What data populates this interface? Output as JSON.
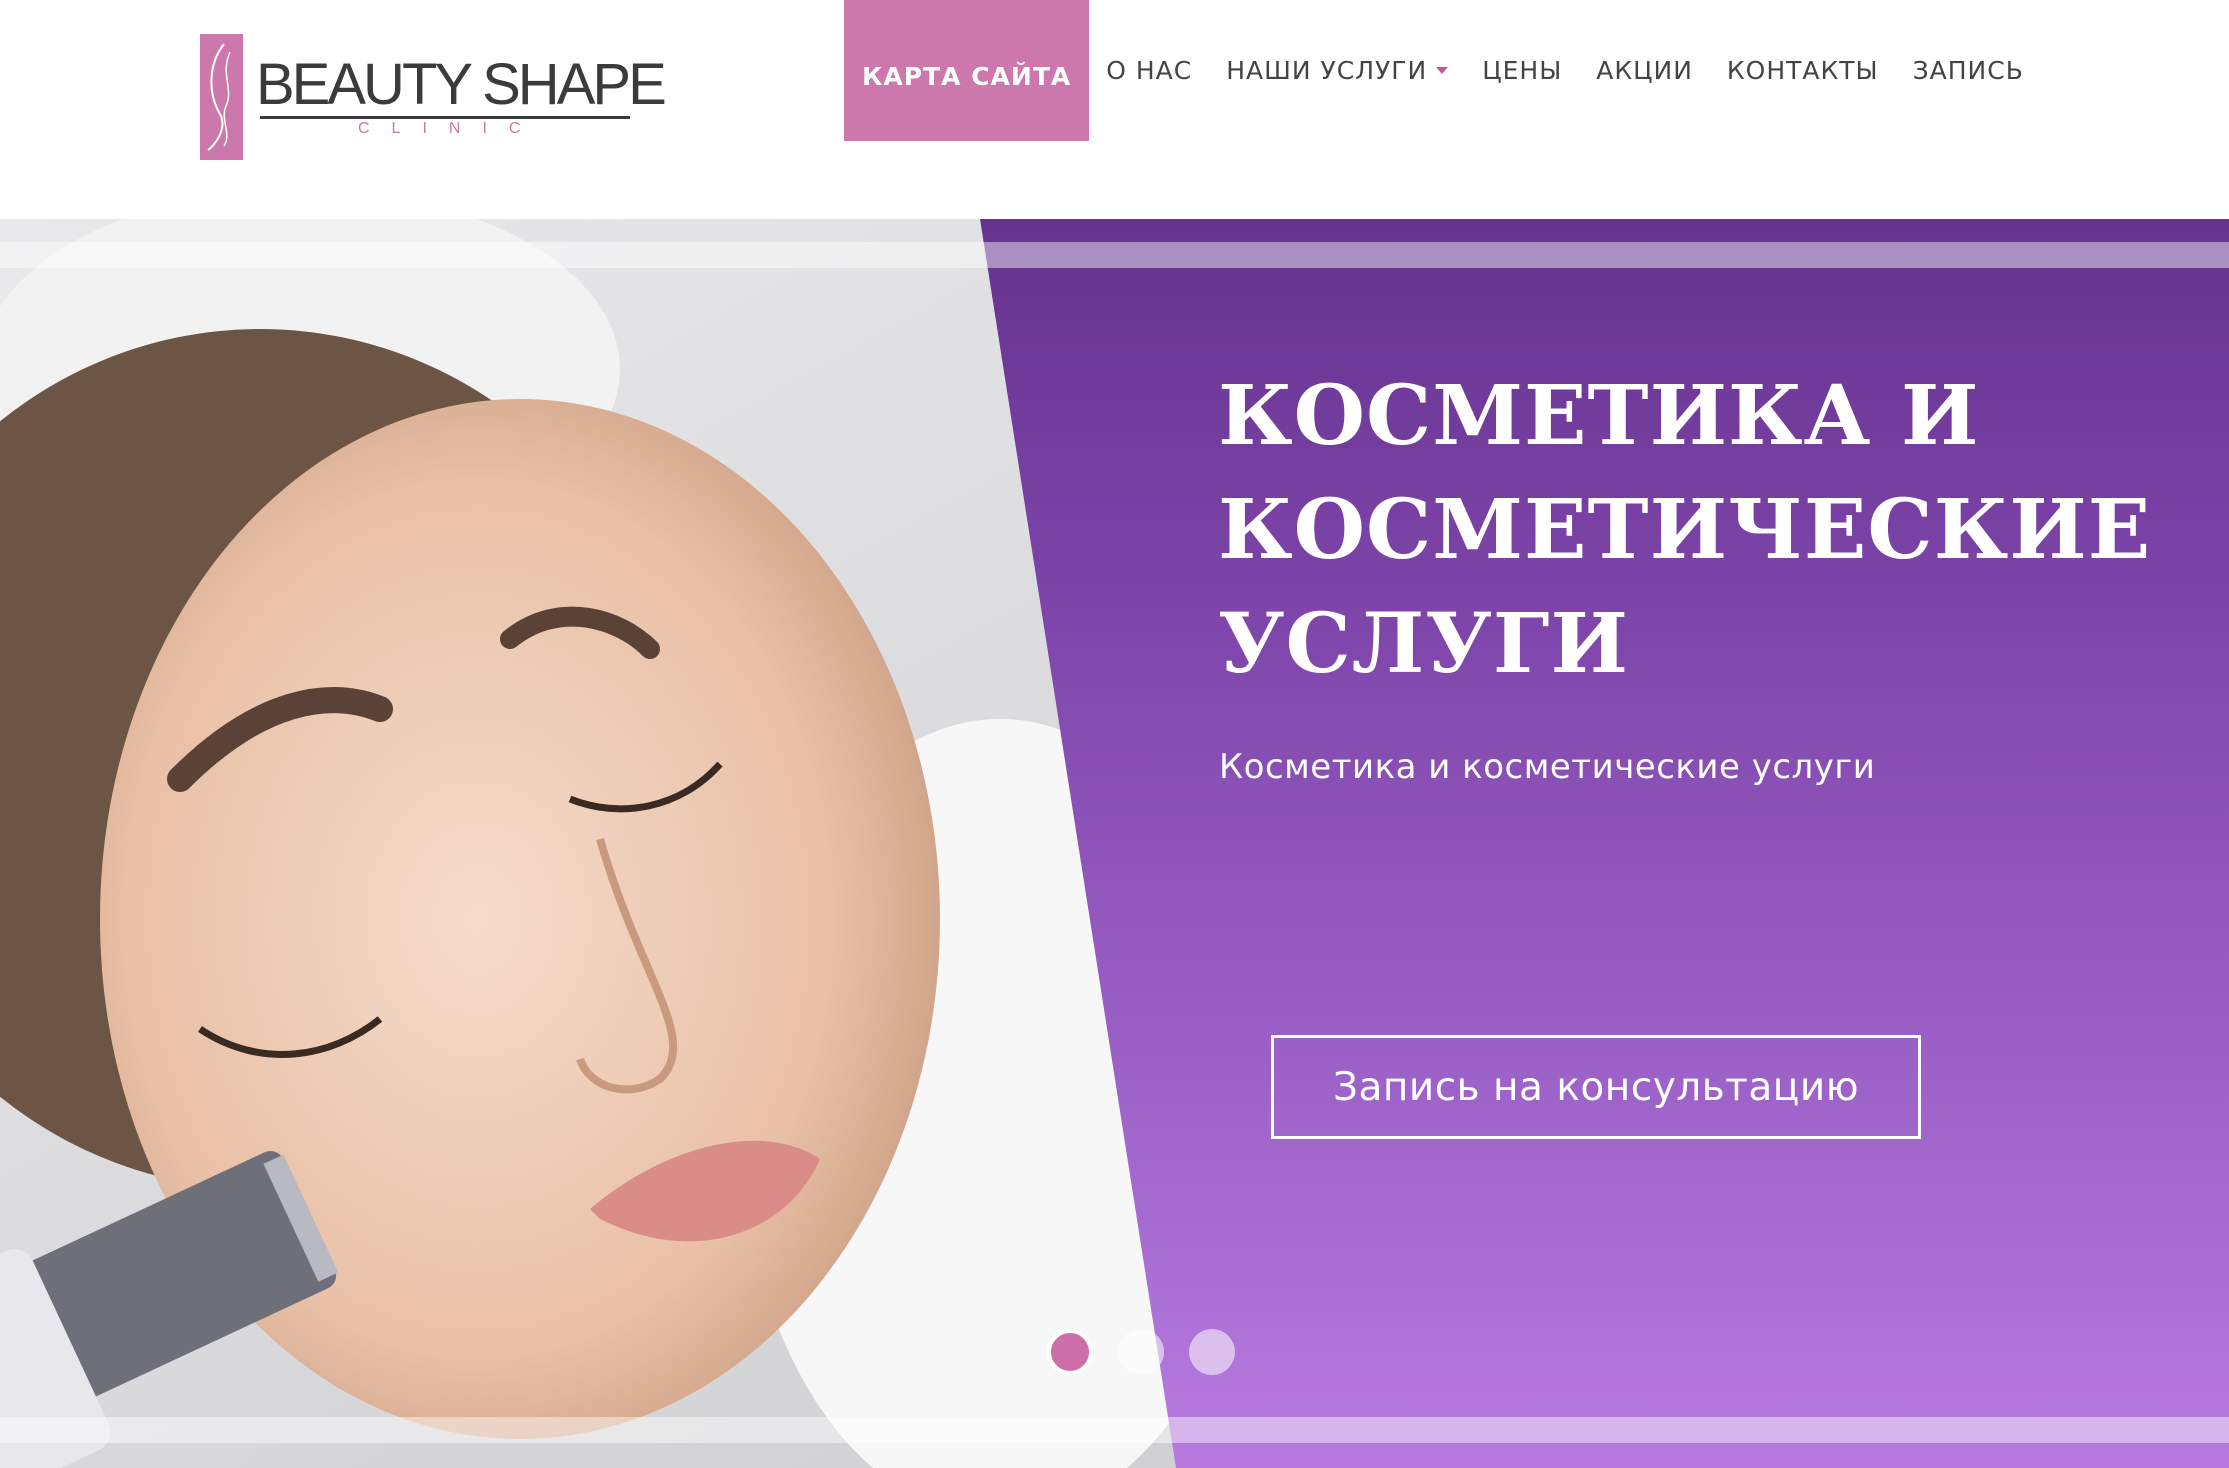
{
  "brand": {
    "name": "BEAUTY SHAPE",
    "sub": "CLINIC",
    "monogram": "BS",
    "accent_color": "#cc78ac"
  },
  "nav": {
    "items": [
      {
        "label": "КАРТА САЙТА",
        "active": true
      },
      {
        "label": "О НАС"
      },
      {
        "label": "НАШИ УСЛУГИ",
        "dropdown": true
      },
      {
        "label": "ЦЕНЫ"
      },
      {
        "label": "АКЦИИ"
      },
      {
        "label": "КОНТАКТЫ"
      },
      {
        "label": "ЗАПИСЬ"
      }
    ]
  },
  "hero": {
    "title_lines": [
      "КОСМЕТИКА И",
      "КОСМЕТИЧЕСКИЕ",
      "УСЛУГИ"
    ],
    "subtitle": "Косметика и косметические услуги",
    "cta_label": "Запись на консультацию",
    "panel_color_top": "#66338e",
    "panel_color_bottom": "#b77be0"
  },
  "slider": {
    "slide_count": 3,
    "active_index": 0
  }
}
